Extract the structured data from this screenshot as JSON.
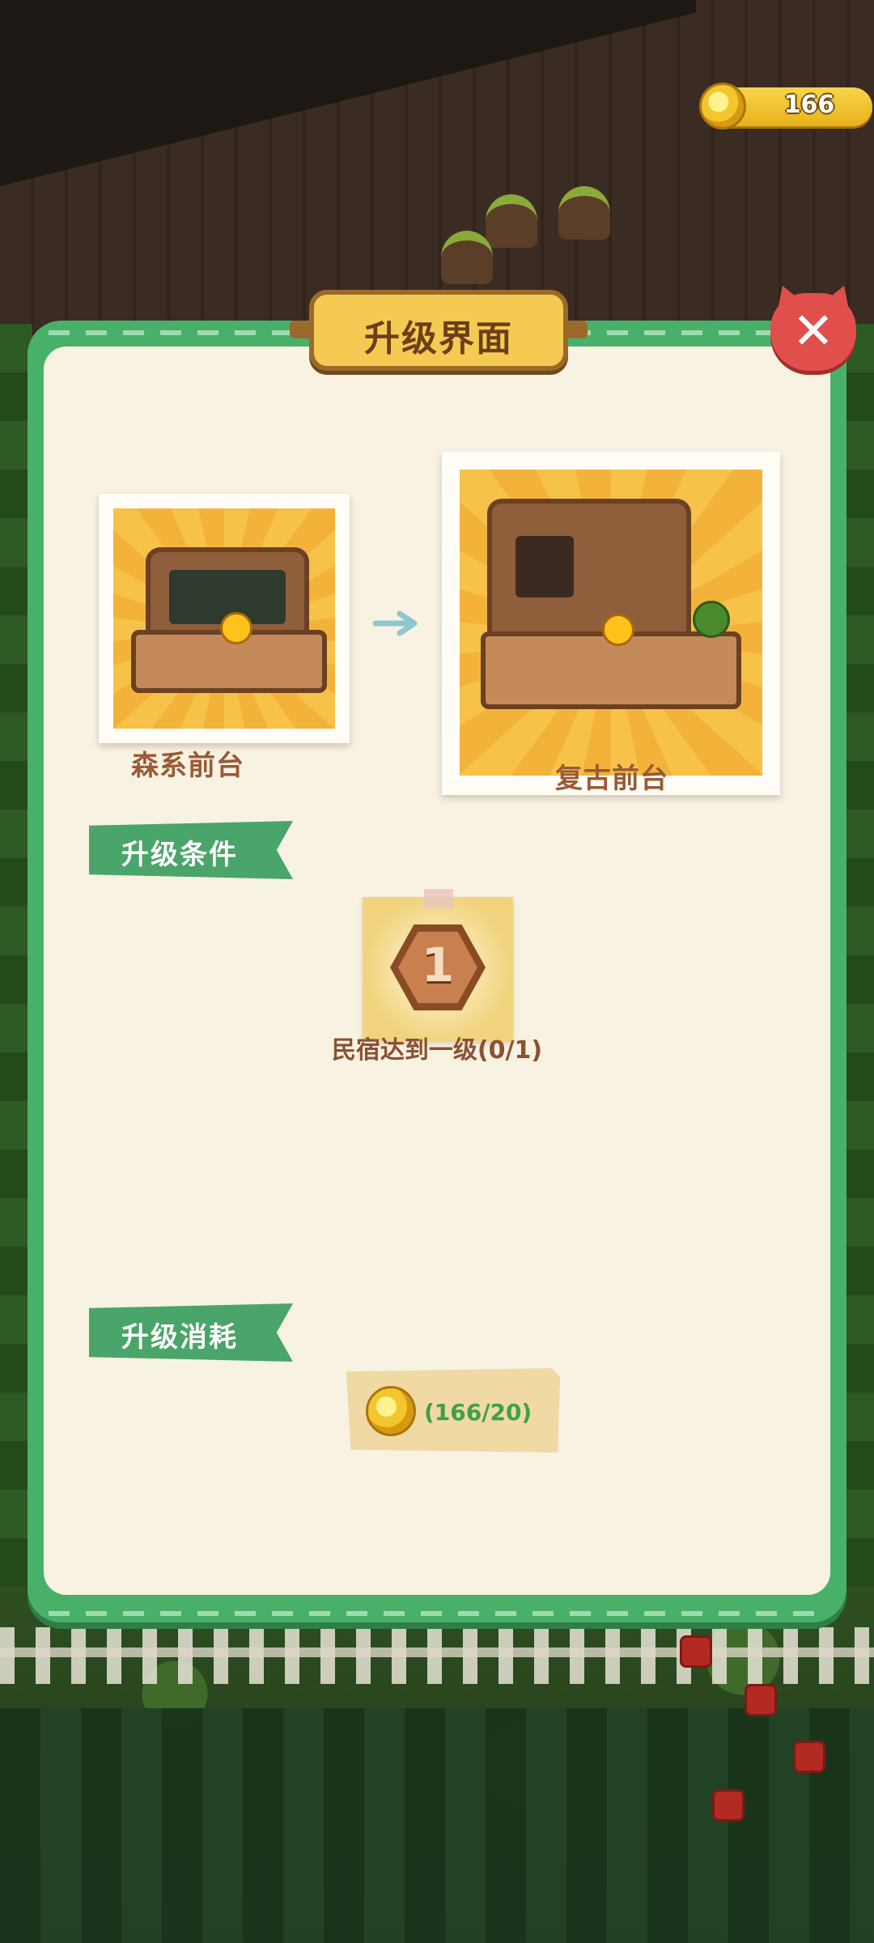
{
  "currency": {
    "icon": "gold-coin-icon",
    "amount": "166"
  },
  "dialog": {
    "title": "升级界面",
    "close_icon": "✕"
  },
  "upgrade": {
    "current_item": {
      "name": "森系前台",
      "icon": "forest-front-desk-icon"
    },
    "arrow_icon": "arrow-right-icon",
    "next_item": {
      "name": "复古前台",
      "icon": "retro-front-desk-icon"
    }
  },
  "conditions": {
    "header": "升级条件",
    "items": [
      {
        "badge_level": "1",
        "label": "民宿达到一级(0/1)"
      }
    ]
  },
  "cost": {
    "header": "升级消耗",
    "items": [
      {
        "icon": "gold-coin-icon",
        "label": "(166/20)"
      }
    ]
  },
  "colors": {
    "panel_border": "#49b06a",
    "panel_bg": "#f8f2e3",
    "title_plaque": "#f4ca52",
    "close_button": "#e04f4b",
    "ribbon": "#4aa56a",
    "item_name": "#9a5a35",
    "cost_text": "#3da04a"
  }
}
